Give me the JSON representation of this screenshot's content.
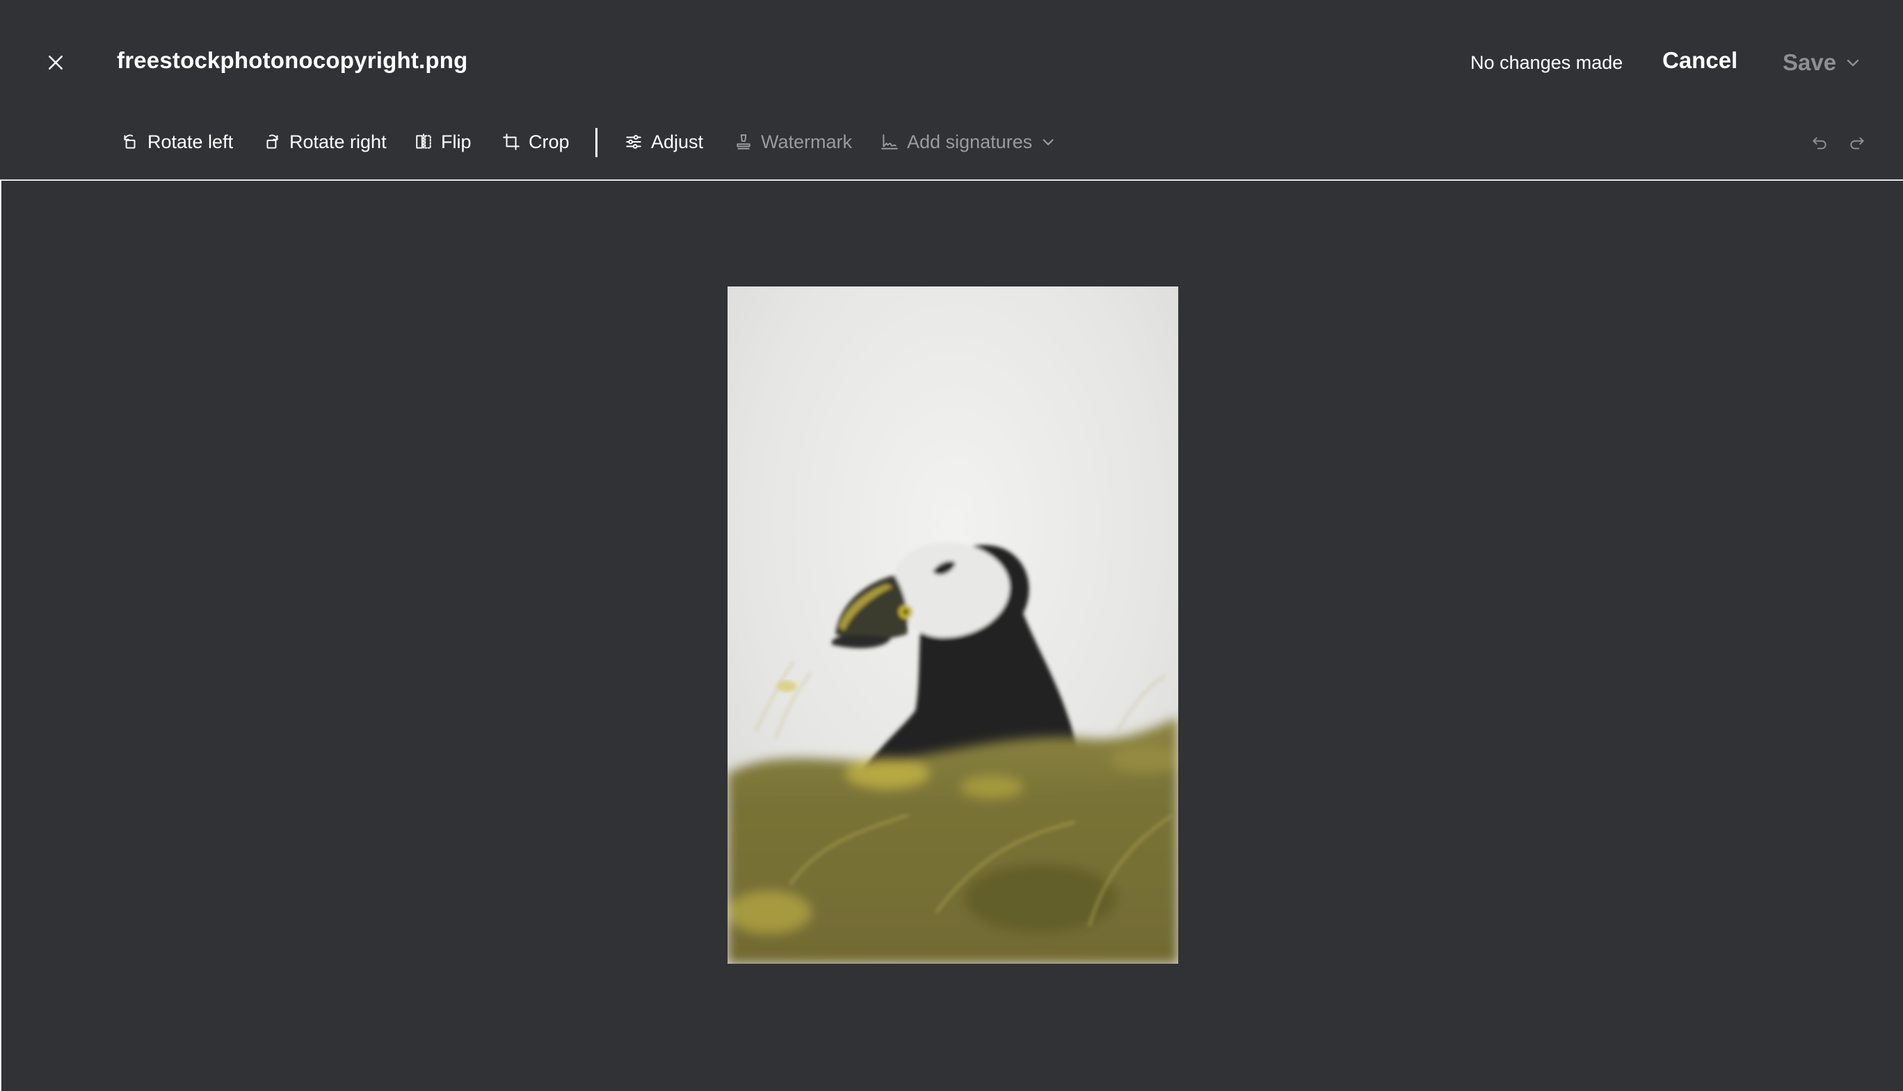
{
  "header": {
    "file_name": "freestockphotonocopyright.png",
    "status": "No changes made",
    "cancel_label": "Cancel",
    "save_label": "Save"
  },
  "toolbar": {
    "tools": [
      {
        "label": "Rotate left",
        "icon": "rotate-left-icon",
        "enabled": true
      },
      {
        "label": "Rotate right",
        "icon": "rotate-right-icon",
        "enabled": true
      },
      {
        "label": "Flip",
        "icon": "flip-icon",
        "enabled": true
      },
      {
        "label": "Crop",
        "icon": "crop-icon",
        "enabled": true
      },
      {
        "label": "Adjust",
        "icon": "adjust-sliders-icon",
        "enabled": true
      },
      {
        "label": "Watermark",
        "icon": "stamp-icon",
        "enabled": false
      },
      {
        "label": "Add signatures",
        "icon": "signature-icon",
        "enabled": false
      }
    ],
    "undo_icon": "undo-icon",
    "redo_icon": "redo-icon"
  },
  "image": {
    "subject": "puffin"
  },
  "colors": {
    "background": "#313236",
    "text": "#ffffff",
    "disabled_text": "#9a9ba0"
  }
}
